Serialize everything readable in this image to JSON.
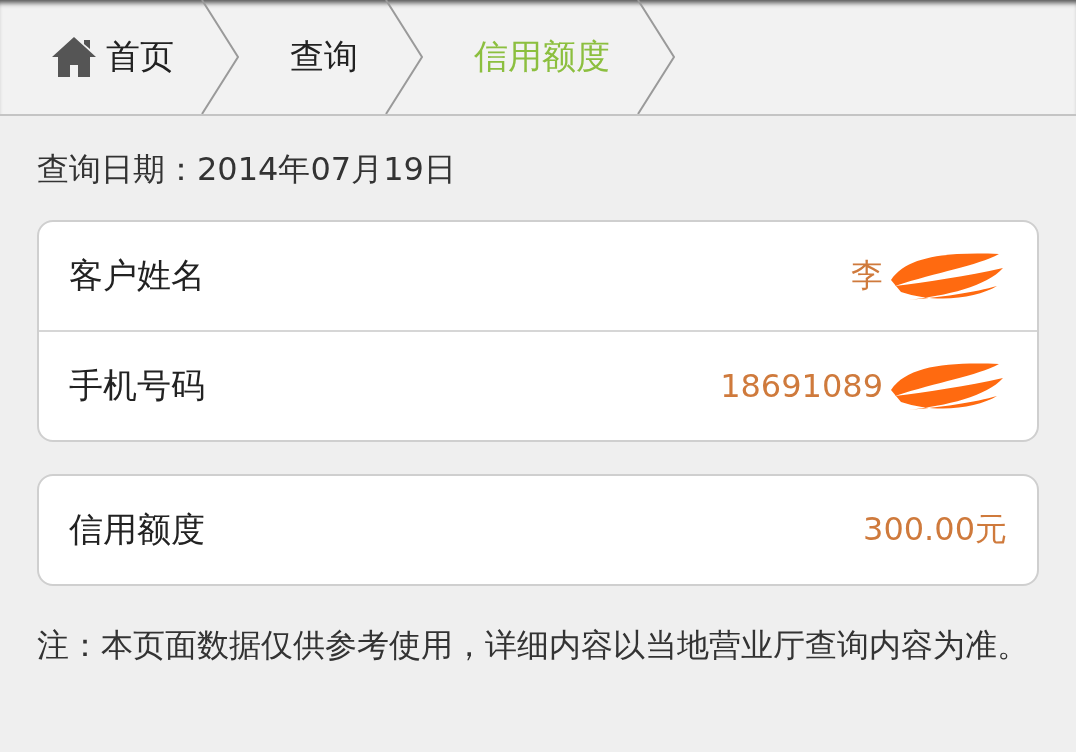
{
  "breadcrumb": [
    {
      "label": "首页",
      "kind": "home",
      "selected": false
    },
    {
      "label": "查询",
      "kind": "plain",
      "selected": false
    },
    {
      "label": "信用额度",
      "kind": "plain",
      "selected": true
    }
  ],
  "query_date": "查询日期：2014年07月19日",
  "cards": [
    {
      "rows": [
        {
          "label": "客户姓名",
          "value": "李",
          "redacted": true
        },
        {
          "label": "手机号码",
          "value": "18691089",
          "redacted": true
        }
      ]
    },
    {
      "rows": [
        {
          "label": "信用额度",
          "value": "300.00元",
          "redacted": false
        }
      ]
    }
  ],
  "note": "注：本页面数据仅供参考使用，详细内容以当地营业厅查询内容为准。"
}
